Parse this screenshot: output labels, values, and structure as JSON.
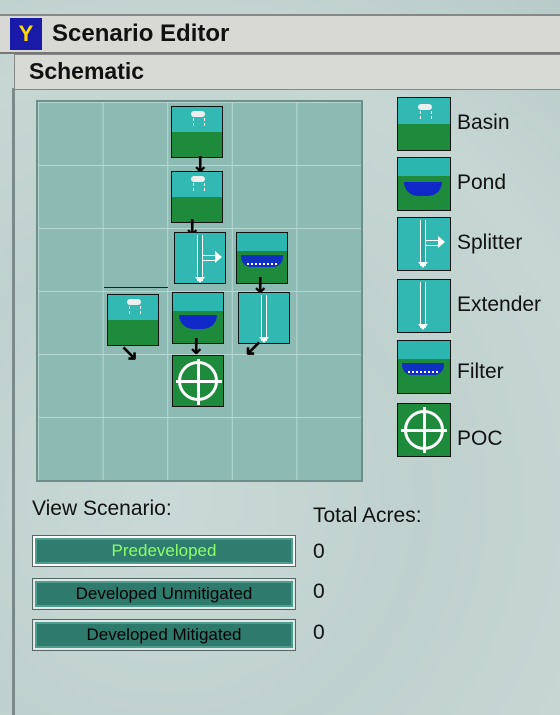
{
  "window": {
    "title": "Scenario Editor"
  },
  "section": {
    "title": "Schematic"
  },
  "legend": [
    {
      "label": "Basin",
      "icon": "basin-icon"
    },
    {
      "label": "Pond",
      "icon": "pond-icon"
    },
    {
      "label": "Splitter",
      "icon": "splitter-icon"
    },
    {
      "label": "Extender",
      "icon": "extender-icon"
    },
    {
      "label": "Filter",
      "icon": "filter-icon"
    },
    {
      "label": "POC",
      "icon": "poc-icon"
    }
  ],
  "view": {
    "label": "View Scenario:"
  },
  "totals": {
    "label": "Total Acres:"
  },
  "scenarios": [
    {
      "label": "Predeveloped",
      "acres": "0",
      "active": true
    },
    {
      "label": "Developed Unmitigated",
      "acres": "0",
      "active": false
    },
    {
      "label": "Developed Mitigated",
      "acres": "0",
      "active": false
    }
  ],
  "colors": {
    "sky": "#33b9b4",
    "ground": "#1e8a3c",
    "water": "#1028c8",
    "active_text": "#8cff6a"
  }
}
